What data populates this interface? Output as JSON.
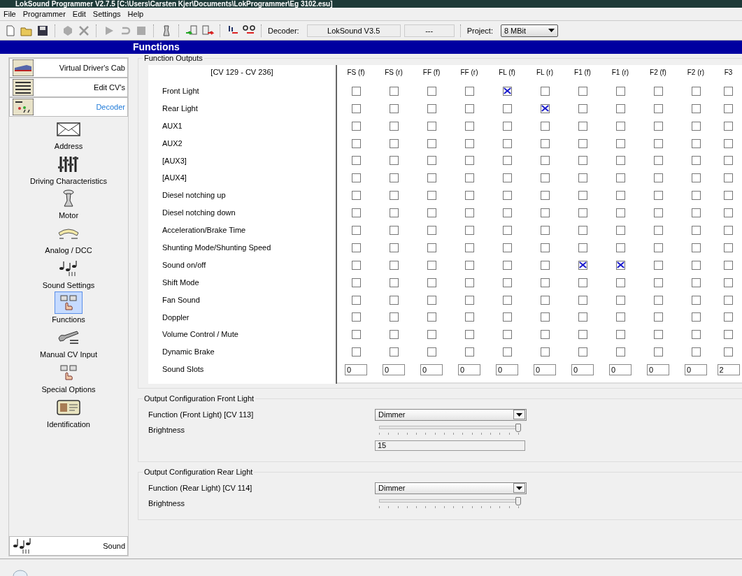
{
  "window": {
    "title": "LokSound Programmer  V2.7.5  [C:\\Users\\Carsten Kjer\\Documents\\LokProgrammer\\Eg 3102.esu]"
  },
  "menu": [
    "File",
    "Programmer",
    "Edit",
    "Settings",
    "Help"
  ],
  "toolbar": {
    "decoder_label": "Decoder:",
    "decoder_value": "LokSound V3.5",
    "decoder_extra": "---",
    "project_label": "Project:",
    "project_value": "8 MBit"
  },
  "header": "Functions",
  "sidebar": {
    "top_items": [
      {
        "label": "Virtual Driver's Cab",
        "kind": "cab",
        "selected": false
      },
      {
        "label": "Edit CV's",
        "kind": "binary",
        "selected": false
      },
      {
        "label": "Decoder",
        "kind": "decoder",
        "selected": true
      }
    ],
    "items": [
      {
        "label": "Address",
        "kind": "envelope",
        "selected": false
      },
      {
        "label": "Driving Characteristics",
        "kind": "sliders",
        "selected": false
      },
      {
        "label": "Motor",
        "kind": "motor",
        "selected": false
      },
      {
        "label": "Analog / DCC",
        "kind": "gauge",
        "selected": false
      },
      {
        "label": "Sound Settings",
        "kind": "notes",
        "selected": false
      },
      {
        "label": "Functions",
        "kind": "fkeys",
        "selected": true
      },
      {
        "label": "Manual CV Input",
        "kind": "wrench",
        "selected": false
      },
      {
        "label": "Special Options",
        "kind": "fkeys",
        "selected": false
      },
      {
        "label": "Identification",
        "kind": "idcard",
        "selected": false
      }
    ],
    "bottom_item": {
      "label": "Sound",
      "kind": "notes",
      "selected": false
    }
  },
  "function_outputs": {
    "title": "Function Outputs",
    "range": "[CV 129 - CV 236]",
    "columns": [
      "FS (f)",
      "FS (r)",
      "FF (f)",
      "FF (r)",
      "FL (f)",
      "FL (r)",
      "F1 (f)",
      "F1 (r)",
      "F2 (f)",
      "F2 (r)",
      "F3"
    ],
    "rows": [
      {
        "label": "Front Light",
        "checked": [
          false,
          false,
          false,
          false,
          true,
          false,
          false,
          false,
          false,
          false,
          false
        ]
      },
      {
        "label": "Rear Light",
        "checked": [
          false,
          false,
          false,
          false,
          false,
          true,
          false,
          false,
          false,
          false,
          false
        ]
      },
      {
        "label": "AUX1",
        "checked": [
          false,
          false,
          false,
          false,
          false,
          false,
          false,
          false,
          false,
          false,
          false
        ]
      },
      {
        "label": "AUX2",
        "checked": [
          false,
          false,
          false,
          false,
          false,
          false,
          false,
          false,
          false,
          false,
          false
        ]
      },
      {
        "label": "[AUX3]",
        "checked": [
          false,
          false,
          false,
          false,
          false,
          false,
          false,
          false,
          false,
          false,
          false
        ]
      },
      {
        "label": "[AUX4]",
        "checked": [
          false,
          false,
          false,
          false,
          false,
          false,
          false,
          false,
          false,
          false,
          false
        ]
      },
      {
        "label": "Diesel notching up",
        "checked": [
          false,
          false,
          false,
          false,
          false,
          false,
          false,
          false,
          false,
          false,
          false
        ]
      },
      {
        "label": "Diesel notching down",
        "checked": [
          false,
          false,
          false,
          false,
          false,
          false,
          false,
          false,
          false,
          false,
          false
        ]
      },
      {
        "label": "Acceleration/Brake Time",
        "checked": [
          false,
          false,
          false,
          false,
          false,
          false,
          false,
          false,
          false,
          false,
          false
        ]
      },
      {
        "label": "Shunting Mode/Shunting Speed",
        "checked": [
          false,
          false,
          false,
          false,
          false,
          false,
          false,
          false,
          false,
          false,
          false
        ]
      },
      {
        "label": "Sound on/off",
        "checked": [
          false,
          false,
          false,
          false,
          false,
          false,
          true,
          true,
          false,
          false,
          false
        ]
      },
      {
        "label": "Shift Mode",
        "checked": [
          false,
          false,
          false,
          false,
          false,
          false,
          false,
          false,
          false,
          false,
          false
        ]
      },
      {
        "label": "Fan Sound",
        "checked": [
          false,
          false,
          false,
          false,
          false,
          false,
          false,
          false,
          false,
          false,
          false
        ]
      },
      {
        "label": "Doppler",
        "checked": [
          false,
          false,
          false,
          false,
          false,
          false,
          false,
          false,
          false,
          false,
          false
        ]
      },
      {
        "label": "Volume Control / Mute",
        "checked": [
          false,
          false,
          false,
          false,
          false,
          false,
          false,
          false,
          false,
          false,
          false
        ]
      },
      {
        "label": "Dynamic Brake",
        "checked": [
          false,
          false,
          false,
          false,
          false,
          false,
          false,
          false,
          false,
          false,
          false
        ]
      }
    ],
    "sound_slots_label": "Sound Slots",
    "sound_slots": [
      "0",
      "0",
      "0",
      "0",
      "0",
      "0",
      "0",
      "0",
      "0",
      "0",
      "2"
    ]
  },
  "output_configs": [
    {
      "title": "Output Configuration Front Light",
      "function_label": "Function (Front Light) [CV 113]",
      "function_value": "Dimmer",
      "brightness_label": "Brightness",
      "level": 1,
      "value": "15"
    },
    {
      "title": "Output Configuration Rear Light",
      "function_label": "Function (Rear Light) [CV 114]",
      "function_value": "Dimmer",
      "brightness_label": "Brightness",
      "level": 1
    }
  ]
}
